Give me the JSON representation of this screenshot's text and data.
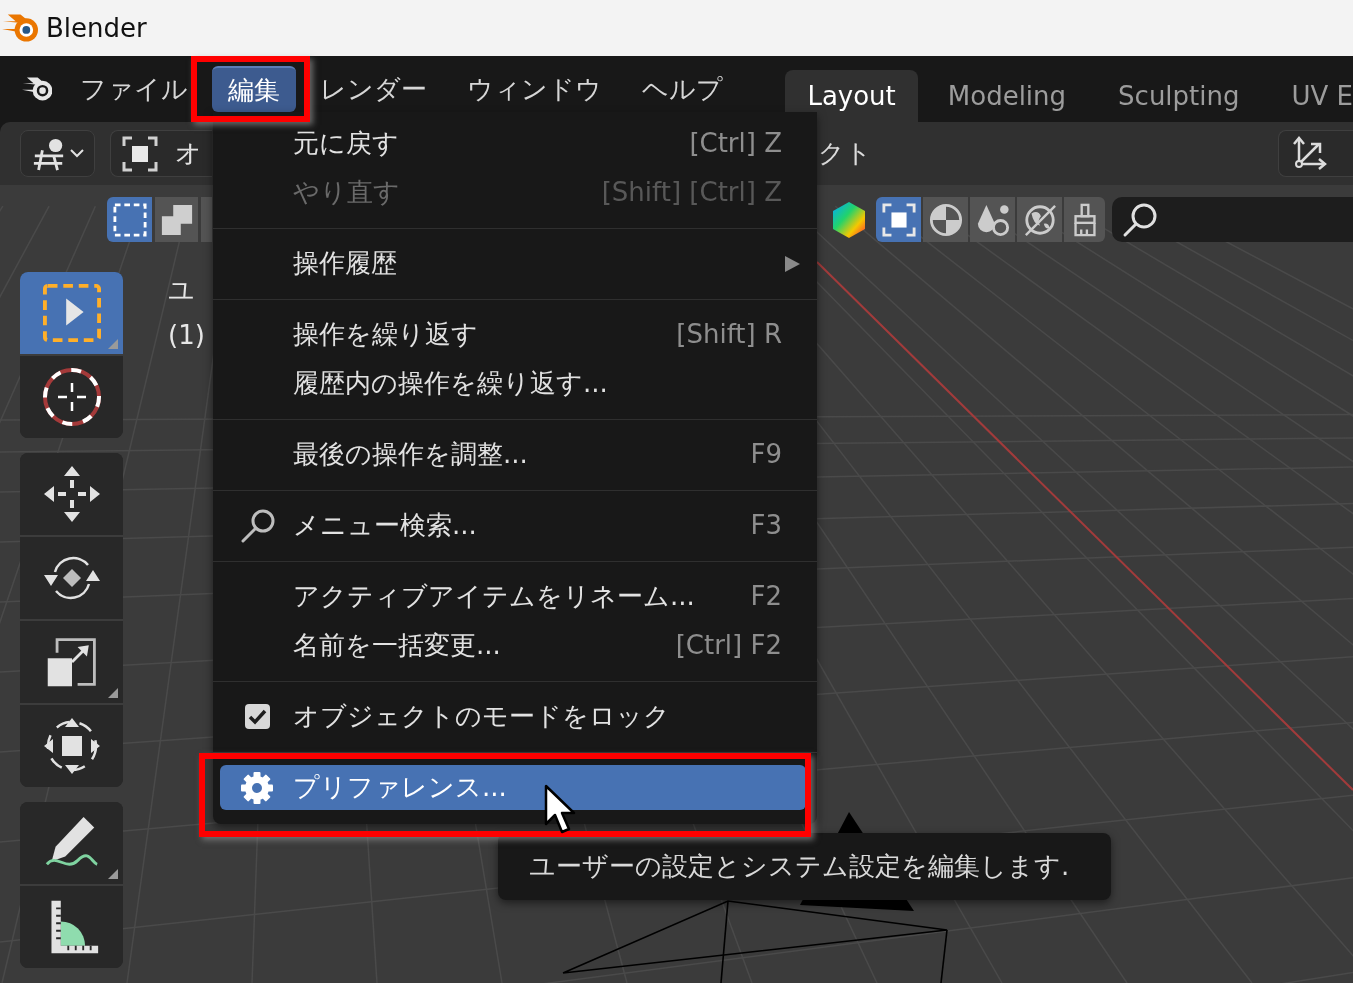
{
  "window": {
    "title": "Blender"
  },
  "menubar": {
    "items": [
      {
        "label": "ファイル",
        "selected": false,
        "annotated": false
      },
      {
        "label": "編集",
        "selected": true,
        "annotated": true
      },
      {
        "label": "レンダー",
        "selected": false,
        "annotated": false
      },
      {
        "label": "ウィンドウ",
        "selected": false,
        "annotated": false
      },
      {
        "label": "ヘルプ",
        "selected": false,
        "annotated": false
      }
    ]
  },
  "workspace_tabs": [
    {
      "label": "Layout",
      "selected": true
    },
    {
      "label": "Modeling",
      "selected": false
    },
    {
      "label": "Sculpting",
      "selected": false
    },
    {
      "label": "UV E",
      "selected": false
    }
  ],
  "viewport_header": {
    "mode_selector": {
      "label": "オ"
    },
    "menu_fragment": "クト"
  },
  "tool_header": {
    "select_modes": [
      {
        "kind": "new",
        "selected": true
      },
      {
        "kind": "extend",
        "selected": false
      },
      {
        "kind": "subtract",
        "selected": false
      }
    ],
    "shading_modes": [
      {
        "kind": "box",
        "selected": true
      },
      {
        "kind": "sphere",
        "selected": false
      },
      {
        "kind": "drops",
        "selected": false
      },
      {
        "kind": "globe",
        "selected": false
      },
      {
        "kind": "brush",
        "selected": false
      }
    ]
  },
  "toolbar": {
    "groups": [
      {
        "tools": [
          {
            "kind": "select-box",
            "selected": true,
            "more": true
          },
          {
            "kind": "cursor",
            "selected": false,
            "more": false
          }
        ]
      },
      {
        "tools": [
          {
            "kind": "move",
            "selected": false,
            "more": false
          },
          {
            "kind": "rotate",
            "selected": false,
            "more": false
          },
          {
            "kind": "scale",
            "selected": false,
            "more": true
          },
          {
            "kind": "transform",
            "selected": false,
            "more": false
          }
        ]
      },
      {
        "tools": [
          {
            "kind": "annotate",
            "selected": false,
            "more": true
          },
          {
            "kind": "measure",
            "selected": false,
            "more": false
          }
        ]
      }
    ]
  },
  "viewport_text": [
    "ユ",
    "(1)"
  ],
  "edit_menu": {
    "sections": [
      {
        "items": [
          {
            "kind": "plain",
            "label": "元に戻す",
            "shortcut": "[Ctrl] Z",
            "disabled": false,
            "selected": false,
            "annotated": false
          },
          {
            "kind": "plain",
            "label": "やり直す",
            "shortcut": "[Shift] [Ctrl] Z",
            "disabled": true,
            "selected": false,
            "annotated": false
          }
        ]
      },
      {
        "items": [
          {
            "kind": "submenu",
            "label": "操作履歴",
            "disabled": false,
            "selected": false,
            "annotated": false
          }
        ]
      },
      {
        "items": [
          {
            "kind": "plain",
            "label": "操作を繰り返す",
            "shortcut": "[Shift] R",
            "disabled": false,
            "selected": false,
            "annotated": false
          },
          {
            "kind": "plain",
            "label": "履歴内の操作を繰り返す...",
            "disabled": false,
            "selected": false,
            "annotated": false
          }
        ]
      },
      {
        "items": [
          {
            "kind": "plain",
            "label": "最後の操作を調整...",
            "shortcut": "F9",
            "disabled": false,
            "selected": false,
            "annotated": false
          }
        ]
      },
      {
        "items": [
          {
            "kind": "search",
            "label": "メニュー検索...",
            "shortcut": "F3",
            "disabled": false,
            "selected": false,
            "annotated": false
          }
        ]
      },
      {
        "items": [
          {
            "kind": "plain",
            "label": "アクティブアイテムをリネーム...",
            "shortcut": "F2",
            "disabled": false,
            "selected": false,
            "annotated": false
          },
          {
            "kind": "plain",
            "label": "名前を一括変更...",
            "shortcut": "[Ctrl] F2",
            "disabled": false,
            "selected": false,
            "annotated": false
          }
        ]
      },
      {
        "items": [
          {
            "kind": "checkbox",
            "label": "オブジェクトのモードをロック",
            "checked": true,
            "disabled": false,
            "selected": false,
            "annotated": false
          }
        ]
      },
      {
        "items": [
          {
            "kind": "gear",
            "label": "プリファレンス...",
            "disabled": false,
            "selected": true,
            "annotated": true
          }
        ]
      }
    ]
  },
  "tooltip": {
    "text": "ユーザーの設定とシステム設定を編集します."
  }
}
